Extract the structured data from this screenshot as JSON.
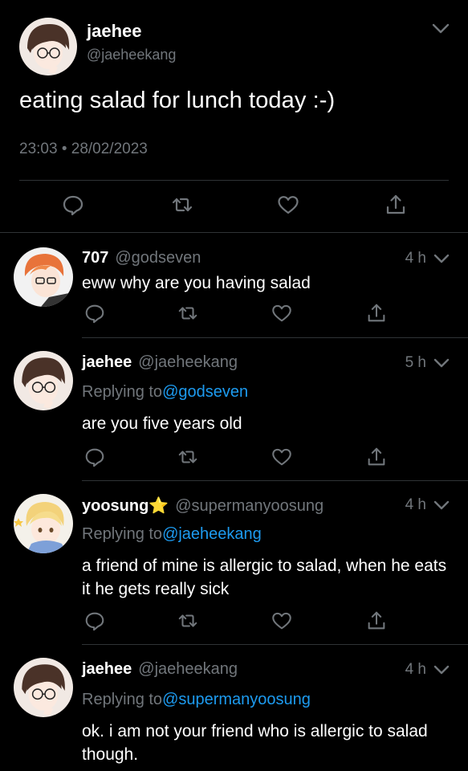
{
  "tweet": {
    "author_name": "jaehee",
    "author_handle": "@jaeheekang",
    "text": "eating salad for lunch today :-)",
    "timestamp": "23:03 • 28/02/2023"
  },
  "replies": [
    {
      "name": "707",
      "handle": "@godseven",
      "time": "4 h",
      "replying_label": "",
      "replying_to": "",
      "body": "eww why are you having salad"
    },
    {
      "name": "jaehee",
      "handle": "@jaeheekang",
      "time": "5 h",
      "replying_label": "Replying to",
      "replying_to": "@godseven",
      "body": "are you five years old"
    },
    {
      "name": "yoosung⭐",
      "handle": "@supermanyoosung",
      "time": "4 h",
      "replying_label": "Replying to",
      "replying_to": "@jaeheekang",
      "body": "a friend of mine is allergic to salad, when he eats it he gets really sick"
    },
    {
      "name": "jaehee",
      "handle": "@jaeheekang",
      "time": "4 h",
      "replying_label": "Replying to",
      "replying_to": "@supermanyoosung",
      "body": "ok. i am not your friend who is allergic to salad though."
    }
  ],
  "icons": {
    "reply": "reply-icon",
    "retweet": "retweet-icon",
    "like": "heart-icon",
    "share": "share-icon",
    "more": "chevron-down-icon"
  },
  "colors": {
    "background": "#000000",
    "secondary_text": "#71767b",
    "mention": "#1d9bf0",
    "divider": "#2f3336"
  }
}
